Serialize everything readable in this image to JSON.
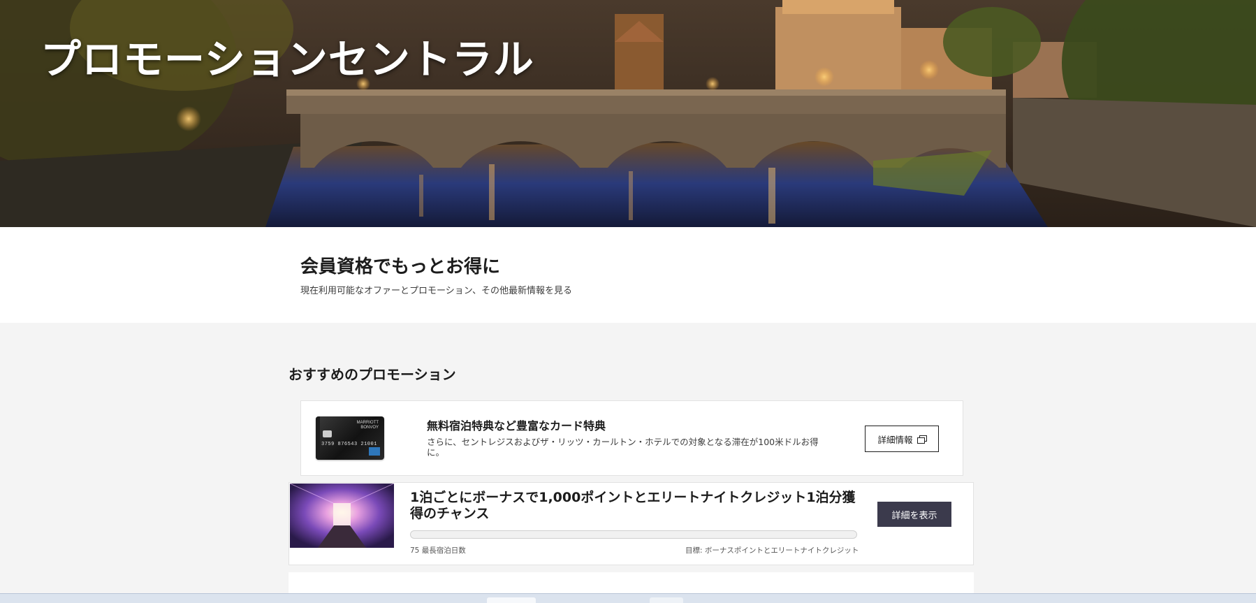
{
  "hero": {
    "title": "プロモーションセントラル"
  },
  "intro": {
    "heading": "会員資格でもっとお得に",
    "subtext": "現在利用可能なオファーとプロモーション、その他最新情報を見る"
  },
  "promotions": {
    "section_title": "おすすめのプロモーション",
    "card_offer": {
      "title": "無料宿泊特典など豊富なカード特典",
      "description": "さらに、セントレジスおよびザ・リッツ・カールトン・ホテルでの対象となる滞在が100米ドルお得に。",
      "button_label": "詳細情報"
    },
    "bonus_offer": {
      "title": "1泊ごとにボーナスで1,000ポイントとエリートナイトクレジット1泊分獲得のチャンス",
      "progress_fraction": 0,
      "stat_left": "75 最長宿泊日数",
      "stat_right": "目標: ボーナスポイントとエリートナイトクレジット",
      "button_label": "詳細を表示"
    }
  },
  "colors": {
    "primary_button": "#3b3a4c",
    "page_background": "#f4f4f4"
  }
}
